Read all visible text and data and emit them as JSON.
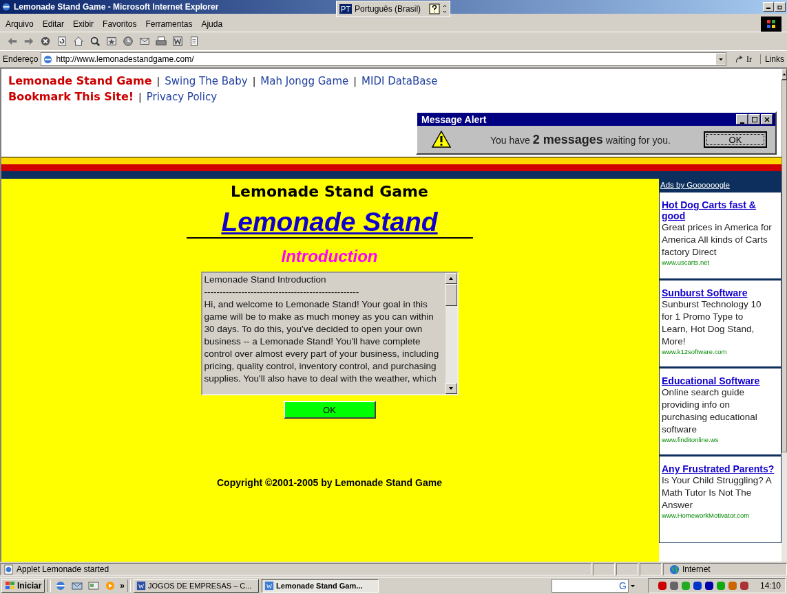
{
  "window": {
    "title": "Lemonade Stand Game - Microsoft Internet Explorer"
  },
  "language_bar": {
    "code": "PT",
    "language": "Português (Brasil)"
  },
  "menu": [
    "Arquivo",
    "Editar",
    "Exibir",
    "Favoritos",
    "Ferramentas",
    "Ajuda"
  ],
  "address_bar": {
    "label": "Endereço",
    "value": "http://www.lemonadestandgame.com/",
    "go": "Ir",
    "links": "Links"
  },
  "site_nav": [
    [
      {
        "kind": "primary",
        "text": "Lemonade Stand Game"
      },
      {
        "kind": "separator",
        "text": "|"
      },
      {
        "kind": "link",
        "text": "Swing The Baby"
      },
      {
        "kind": "separator",
        "text": "|"
      },
      {
        "kind": "link",
        "text": "Mah Jongg Game"
      },
      {
        "kind": "separator",
        "text": "|"
      },
      {
        "kind": "link",
        "text": "MIDI DataBase"
      }
    ],
    [
      {
        "kind": "primary",
        "text": "Bookmark This Site!"
      },
      {
        "kind": "separator",
        "text": "|"
      },
      {
        "kind": "link",
        "text": "Privacy Policy"
      }
    ]
  ],
  "message_alert": {
    "title": "Message Alert",
    "text": "You have **2 messages** waiting for you.",
    "button": "OK"
  },
  "game": {
    "heading": "Lemonade Stand Game",
    "title": "Lemonade Stand",
    "subtitle": "Introduction",
    "text_lines": [
      "Lemonade Stand Introduction",
      "--------------------------------------------------",
      "Hi, and welcome to Lemonade Stand!  Your goal in this game will be to make as much money as you can within 30 days.  To do this, you've decided to open your own business -- a Lemonade Stand!  You'll have complete control over almost every part of your business, including pricing, quality control, inventory control, and purchasing supplies.  You'll also have to deal with the weather, which"
    ],
    "button": "OK",
    "copyright": "Copyright ©2001-2005 by Lemonade Stand Game"
  },
  "ads": {
    "header": "Ads by Goooooogle",
    "items": [
      {
        "title": "Hot Dog Carts fast & good",
        "text": "Great prices in America for America All kinds of Carts factory Direct",
        "url": "www.uscarts.net"
      },
      {
        "title": "Sunburst Software",
        "text": "Sunburst Technology 10 for 1 Promo Type to Learn, Hot Dog Stand, More!",
        "url": "www.k12software.com"
      },
      {
        "title": "Educational Software",
        "text": "Online search guide providing info on purchasing educational software",
        "url": "www.finditonline.ws"
      },
      {
        "title": "Any Frustrated Parents?",
        "text": "Is Your Child Struggling? A Math Tutor Is Not The Answer",
        "url": "www.HomeworkMotivator.com"
      }
    ]
  },
  "status_bar": {
    "text": "Applet Lemonade started",
    "zone": "Internet"
  },
  "taskbar": {
    "start": "Iniciar",
    "more": "»",
    "tasks": [
      {
        "label": "JOGOS DE EMPRESAS – C...",
        "selected": false
      },
      {
        "label": "Lemonade Stand Gam...",
        "selected": true
      }
    ],
    "search_mark": "G",
    "clock": "14:10"
  }
}
